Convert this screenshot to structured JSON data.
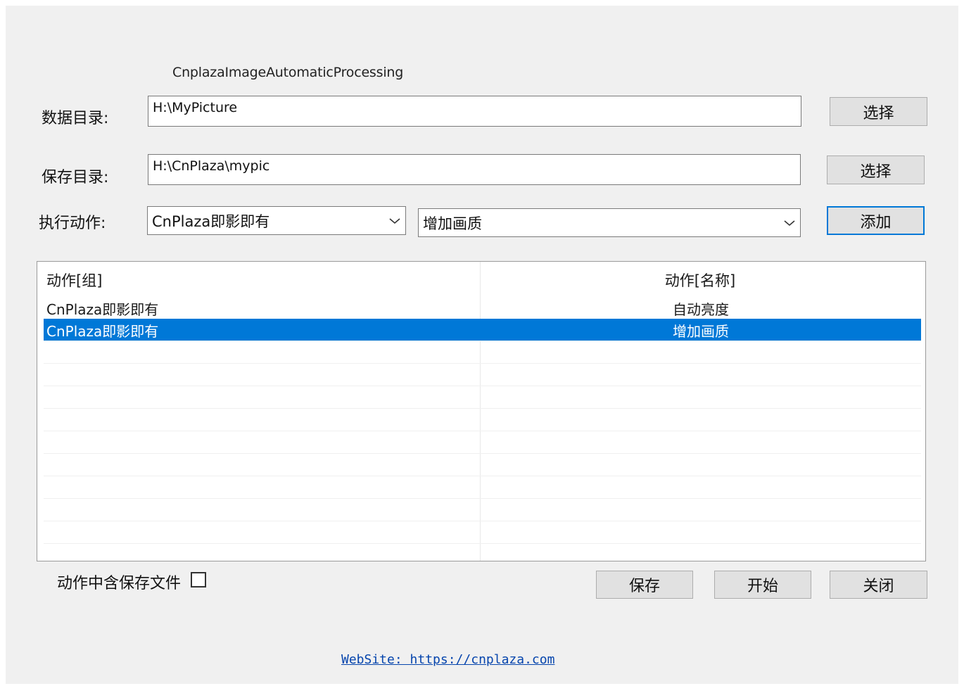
{
  "window": {
    "title": "CnplazaImageAutomaticProcessing"
  },
  "data_dir": {
    "label": "数据目录:",
    "value": "H:\\MyPicture",
    "button": "选择"
  },
  "save_dir": {
    "label": "保存目录:",
    "value": "H:\\CnPlaza\\mypic",
    "button": "选择"
  },
  "action": {
    "label": "执行动作:",
    "group_selected": "CnPlaza即影即有",
    "name_selected": "增加画质",
    "add_button": "添加"
  },
  "list": {
    "columns": [
      "动作[组]",
      "动作[名称]"
    ],
    "rows": [
      {
        "group": "CnPlaza即影即有",
        "name": "自动亮度",
        "selected": false
      },
      {
        "group": "CnPlaza即影即有",
        "name": "增加画质",
        "selected": true
      }
    ]
  },
  "options": {
    "include_save_label": "动作中含保存文件",
    "include_save_checked": false
  },
  "buttons": {
    "save": "保存",
    "start": "开始",
    "close": "关闭"
  },
  "footer": {
    "website": "WebSite:  https://cnplaza.com"
  },
  "colors": {
    "selection": "#0078d7",
    "link": "#0645ad",
    "window_bg": "#f0f0f0"
  },
  "icons": {
    "combo_arrow": "chevron-down-icon"
  }
}
